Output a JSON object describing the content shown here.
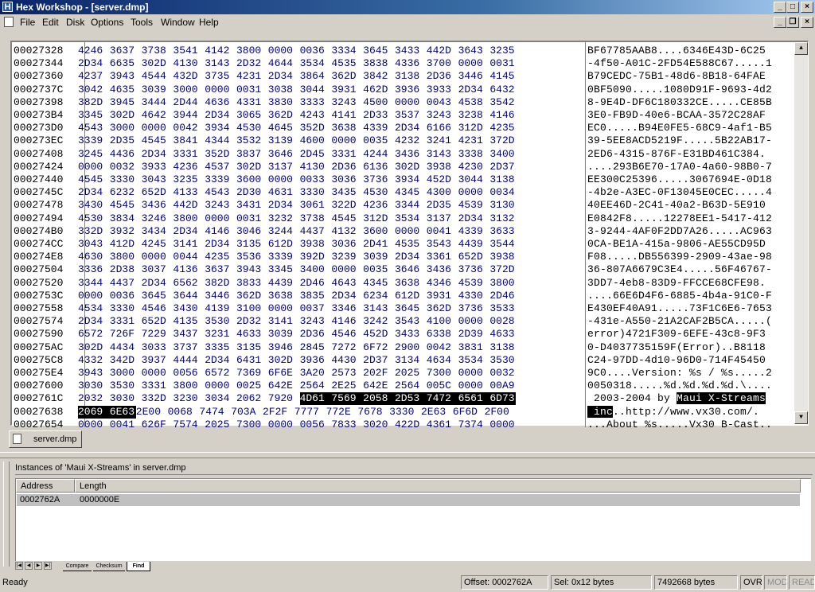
{
  "window": {
    "title": "Hex Workshop - [server.dmp]",
    "app_icon_letter": "H"
  },
  "menu": [
    "File",
    "Edit",
    "Disk",
    "Options",
    "Tools",
    "Window",
    "Help"
  ],
  "hex_rows": [
    {
      "addr": "00027328",
      "hex": [
        "4246",
        "3637",
        "3738",
        "3541",
        "4142",
        "3800",
        "0000",
        "0036",
        "3334",
        "3645",
        "3433",
        "442D",
        "3643",
        "3235"
      ],
      "ascii": "BF67785AAB8....6346E43D-6C25"
    },
    {
      "addr": "00027344",
      "hex": [
        "2D34",
        "6635",
        "302D",
        "4130",
        "3143",
        "2D32",
        "4644",
        "3534",
        "4535",
        "3838",
        "4336",
        "3700",
        "0000",
        "0031"
      ],
      "ascii": "-4f50-A01C-2FD54E588C67.....1"
    },
    {
      "addr": "00027360",
      "hex": [
        "4237",
        "3943",
        "4544",
        "432D",
        "3735",
        "4231",
        "2D34",
        "3864",
        "362D",
        "3842",
        "3138",
        "2D36",
        "3446",
        "4145"
      ],
      "ascii": "B79CEDC-75B1-48d6-8B18-64FAE"
    },
    {
      "addr": "0002737C",
      "hex": [
        "3042",
        "4635",
        "3039",
        "3000",
        "0000",
        "0031",
        "3038",
        "3044",
        "3931",
        "462D",
        "3936",
        "3933",
        "2D34",
        "6432"
      ],
      "ascii": "0BF5090.....1080D91F-9693-4d2"
    },
    {
      "addr": "00027398",
      "hex": [
        "382D",
        "3945",
        "3444",
        "2D44",
        "4636",
        "4331",
        "3830",
        "3333",
        "3243",
        "4500",
        "0000",
        "0043",
        "4538",
        "3542"
      ],
      "ascii": "8-9E4D-DF6C180332CE.....CE85B"
    },
    {
      "addr": "000273B4",
      "hex": [
        "3345",
        "302D",
        "4642",
        "3944",
        "2D34",
        "3065",
        "362D",
        "4243",
        "4141",
        "2D33",
        "3537",
        "3243",
        "3238",
        "4146"
      ],
      "ascii": "3E0-FB9D-40e6-BCAA-3572C28AF"
    },
    {
      "addr": "000273D0",
      "hex": [
        "4543",
        "3000",
        "0000",
        "0042",
        "3934",
        "4530",
        "4645",
        "352D",
        "3638",
        "4339",
        "2D34",
        "6166",
        "312D",
        "4235"
      ],
      "ascii": "EC0.....B94E0FE5-68C9-4af1-B5"
    },
    {
      "addr": "000273EC",
      "hex": [
        "3339",
        "2D35",
        "4545",
        "3841",
        "4344",
        "3532",
        "3139",
        "4600",
        "0000",
        "0035",
        "4232",
        "3241",
        "4231",
        "372D"
      ],
      "ascii": "39-5EE8ACD5219F.....5B22AB17-"
    },
    {
      "addr": "00027408",
      "hex": [
        "3245",
        "4436",
        "2D34",
        "3331",
        "352D",
        "3837",
        "3646",
        "2D45",
        "3331",
        "4244",
        "3436",
        "3143",
        "3338",
        "3400"
      ],
      "ascii": "2ED6-4315-876F-E31BD461C384."
    },
    {
      "addr": "00027424",
      "hex": [
        "0000",
        "0032",
        "3933",
        "4236",
        "4537",
        "302D",
        "3137",
        "4130",
        "2D36",
        "6136",
        "302D",
        "3938",
        "4230",
        "2D37"
      ],
      "ascii": "....293B6E70-17A0-4a60-98B0-7"
    },
    {
      "addr": "00027440",
      "hex": [
        "4545",
        "3330",
        "3043",
        "3235",
        "3339",
        "3600",
        "0000",
        "0033",
        "3036",
        "3736",
        "3934",
        "452D",
        "3044",
        "3138"
      ],
      "ascii": "EE300C25396.....3067694E-0D18"
    },
    {
      "addr": "0002745C",
      "hex": [
        "2D34",
        "6232",
        "652D",
        "4133",
        "4543",
        "2D30",
        "4631",
        "3330",
        "3435",
        "4530",
        "4345",
        "4300",
        "0000",
        "0034"
      ],
      "ascii": "-4b2e-A3EC-0F13045E0CEC.....4"
    },
    {
      "addr": "00027478",
      "hex": [
        "3430",
        "4545",
        "3436",
        "442D",
        "3243",
        "3431",
        "2D34",
        "3061",
        "322D",
        "4236",
        "3344",
        "2D35",
        "4539",
        "3130"
      ],
      "ascii": "40EE46D-2C41-40a2-B63D-5E910"
    },
    {
      "addr": "00027494",
      "hex": [
        "4530",
        "3834",
        "3246",
        "3800",
        "0000",
        "0031",
        "3232",
        "3738",
        "4545",
        "312D",
        "3534",
        "3137",
        "2D34",
        "3132"
      ],
      "ascii": "E0842F8.....12278EE1-5417-412"
    },
    {
      "addr": "000274B0",
      "hex": [
        "332D",
        "3932",
        "3434",
        "2D34",
        "4146",
        "3046",
        "3244",
        "4437",
        "4132",
        "3600",
        "0000",
        "0041",
        "4339",
        "3633"
      ],
      "ascii": "3-9244-4AF0F2DD7A26.....AC963"
    },
    {
      "addr": "000274CC",
      "hex": [
        "3043",
        "412D",
        "4245",
        "3141",
        "2D34",
        "3135",
        "612D",
        "3938",
        "3036",
        "2D41",
        "4535",
        "3543",
        "4439",
        "3544"
      ],
      "ascii": "0CA-BE1A-415a-9806-AE55CD95D"
    },
    {
      "addr": "000274E8",
      "hex": [
        "4630",
        "3800",
        "0000",
        "0044",
        "4235",
        "3536",
        "3339",
        "392D",
        "3239",
        "3039",
        "2D34",
        "3361",
        "652D",
        "3938"
      ],
      "ascii": "F08.....DB556399-2909-43ae-98"
    },
    {
      "addr": "00027504",
      "hex": [
        "3336",
        "2D38",
        "3037",
        "4136",
        "3637",
        "3943",
        "3345",
        "3400",
        "0000",
        "0035",
        "3646",
        "3436",
        "3736",
        "372D"
      ],
      "ascii": "36-807A6679C3E4.....56F46767-"
    },
    {
      "addr": "00027520",
      "hex": [
        "3344",
        "4437",
        "2D34",
        "6562",
        "382D",
        "3833",
        "4439",
        "2D46",
        "4643",
        "4345",
        "3638",
        "4346",
        "4539",
        "3800"
      ],
      "ascii": "3DD7-4eb8-83D9-FFCCE68CFE98."
    },
    {
      "addr": "0002753C",
      "hex": [
        "0000",
        "0036",
        "3645",
        "3644",
        "3446",
        "362D",
        "3638",
        "3835",
        "2D34",
        "6234",
        "612D",
        "3931",
        "4330",
        "2D46"
      ],
      "ascii": "....66E6D4F6-6885-4b4a-91C0-F"
    },
    {
      "addr": "00027558",
      "hex": [
        "4534",
        "3330",
        "4546",
        "3430",
        "4139",
        "3100",
        "0000",
        "0037",
        "3346",
        "3143",
        "3645",
        "362D",
        "3736",
        "3533"
      ],
      "ascii": "E430EF40A91.....73F1C6E6-7653"
    },
    {
      "addr": "00027574",
      "hex": [
        "2D34",
        "3331",
        "652D",
        "4135",
        "3530",
        "2D32",
        "3141",
        "3243",
        "4146",
        "3242",
        "3543",
        "4100",
        "0000",
        "0028"
      ],
      "ascii": "-431e-A550-21A2CAF2B5CA.....("
    },
    {
      "addr": "00027590",
      "hex": [
        "6572",
        "726F",
        "7229",
        "3437",
        "3231",
        "4633",
        "3039",
        "2D36",
        "4546",
        "452D",
        "3433",
        "6338",
        "2D39",
        "4633"
      ],
      "ascii": "error)4721F309-6EFE-43c8-9F3"
    },
    {
      "addr": "000275AC",
      "hex": [
        "302D",
        "4434",
        "3033",
        "3737",
        "3335",
        "3135",
        "3946",
        "2845",
        "7272",
        "6F72",
        "2900",
        "0042",
        "3831",
        "3138"
      ],
      "ascii": "0-D4037735159F(Error)..B8118"
    },
    {
      "addr": "000275C8",
      "hex": [
        "4332",
        "342D",
        "3937",
        "4444",
        "2D34",
        "6431",
        "302D",
        "3936",
        "4430",
        "2D37",
        "3134",
        "4634",
        "3534",
        "3530"
      ],
      "ascii": "C24-97DD-4d10-96D0-714F45450"
    },
    {
      "addr": "000275E4",
      "hex": [
        "3943",
        "3000",
        "0000",
        "0056",
        "6572",
        "7369",
        "6F6E",
        "3A20",
        "2573",
        "202F",
        "2025",
        "7300",
        "0000",
        "0032"
      ],
      "ascii": "9C0....Version: %s / %s.....2"
    },
    {
      "addr": "00027600",
      "hex": [
        "3030",
        "3530",
        "3331",
        "3800",
        "0000",
        "0025",
        "642E",
        "2564",
        "2E25",
        "642E",
        "2564",
        "005C",
        "0000",
        "00A9"
      ],
      "ascii": "0050318.....%d.%d.%d.%d.\\...."
    },
    {
      "addr": "0002761C",
      "hex": [
        "2032",
        "3030",
        "332D",
        "3230",
        "3034",
        "2062",
        "7920",
        "4D61",
        "7569",
        "2058",
        "2D53",
        "7472",
        "6561",
        "6D73"
      ],
      "ascii": " 2003-2004 by Maui X-Streams"
    },
    {
      "addr": "00027638",
      "hex": [
        "2069",
        "6E63",
        "2E00",
        "0068",
        "7474",
        "703A",
        "2F2F",
        "7777",
        "772E",
        "7678",
        "3330",
        "2E63",
        "6F6D",
        "2F00"
      ],
      "ascii": " inc..http://www.vx30.com/."
    },
    {
      "addr": "00027654",
      "hex": [
        "0000",
        "0041",
        "626F",
        "7574",
        "2025",
        "7300",
        "0000",
        "0056",
        "7833",
        "3020",
        "422D",
        "4361",
        "7374",
        "0000"
      ],
      "ascii": "...About %s.....Vx30 B-Cast.."
    }
  ],
  "selection": {
    "row1_index": 27,
    "row1_first_cell": 7,
    "ascii1_prefix": " 2003-2004 by ",
    "ascii1_sel": "Maui X-Streams",
    "row2_index": 28,
    "row2_cells": 2,
    "ascii2_sel": " inc",
    "ascii2_rest": "..http://www.vx30.com/."
  },
  "file_tab": {
    "label": "server.dmp"
  },
  "results": {
    "title": "Instances of 'Maui X-Streams' in server.dmp",
    "columns": [
      "Address",
      "Length"
    ],
    "rows": [
      {
        "address": "0002762A",
        "length": "0000000E"
      }
    ],
    "tabs": [
      "Compare",
      "Checksum",
      "Find"
    ],
    "active_tab": "Find"
  },
  "status": {
    "ready": "Ready",
    "offset": "Offset: 0002762A",
    "sel": "Sel: 0x12 bytes",
    "size": "7492668 bytes",
    "ovr": "OVR",
    "mod": "MOD",
    "read": "READ"
  },
  "colors": {
    "hex_blue": "#000080",
    "selection": "#000000",
    "title_bar": "#0a246a"
  }
}
